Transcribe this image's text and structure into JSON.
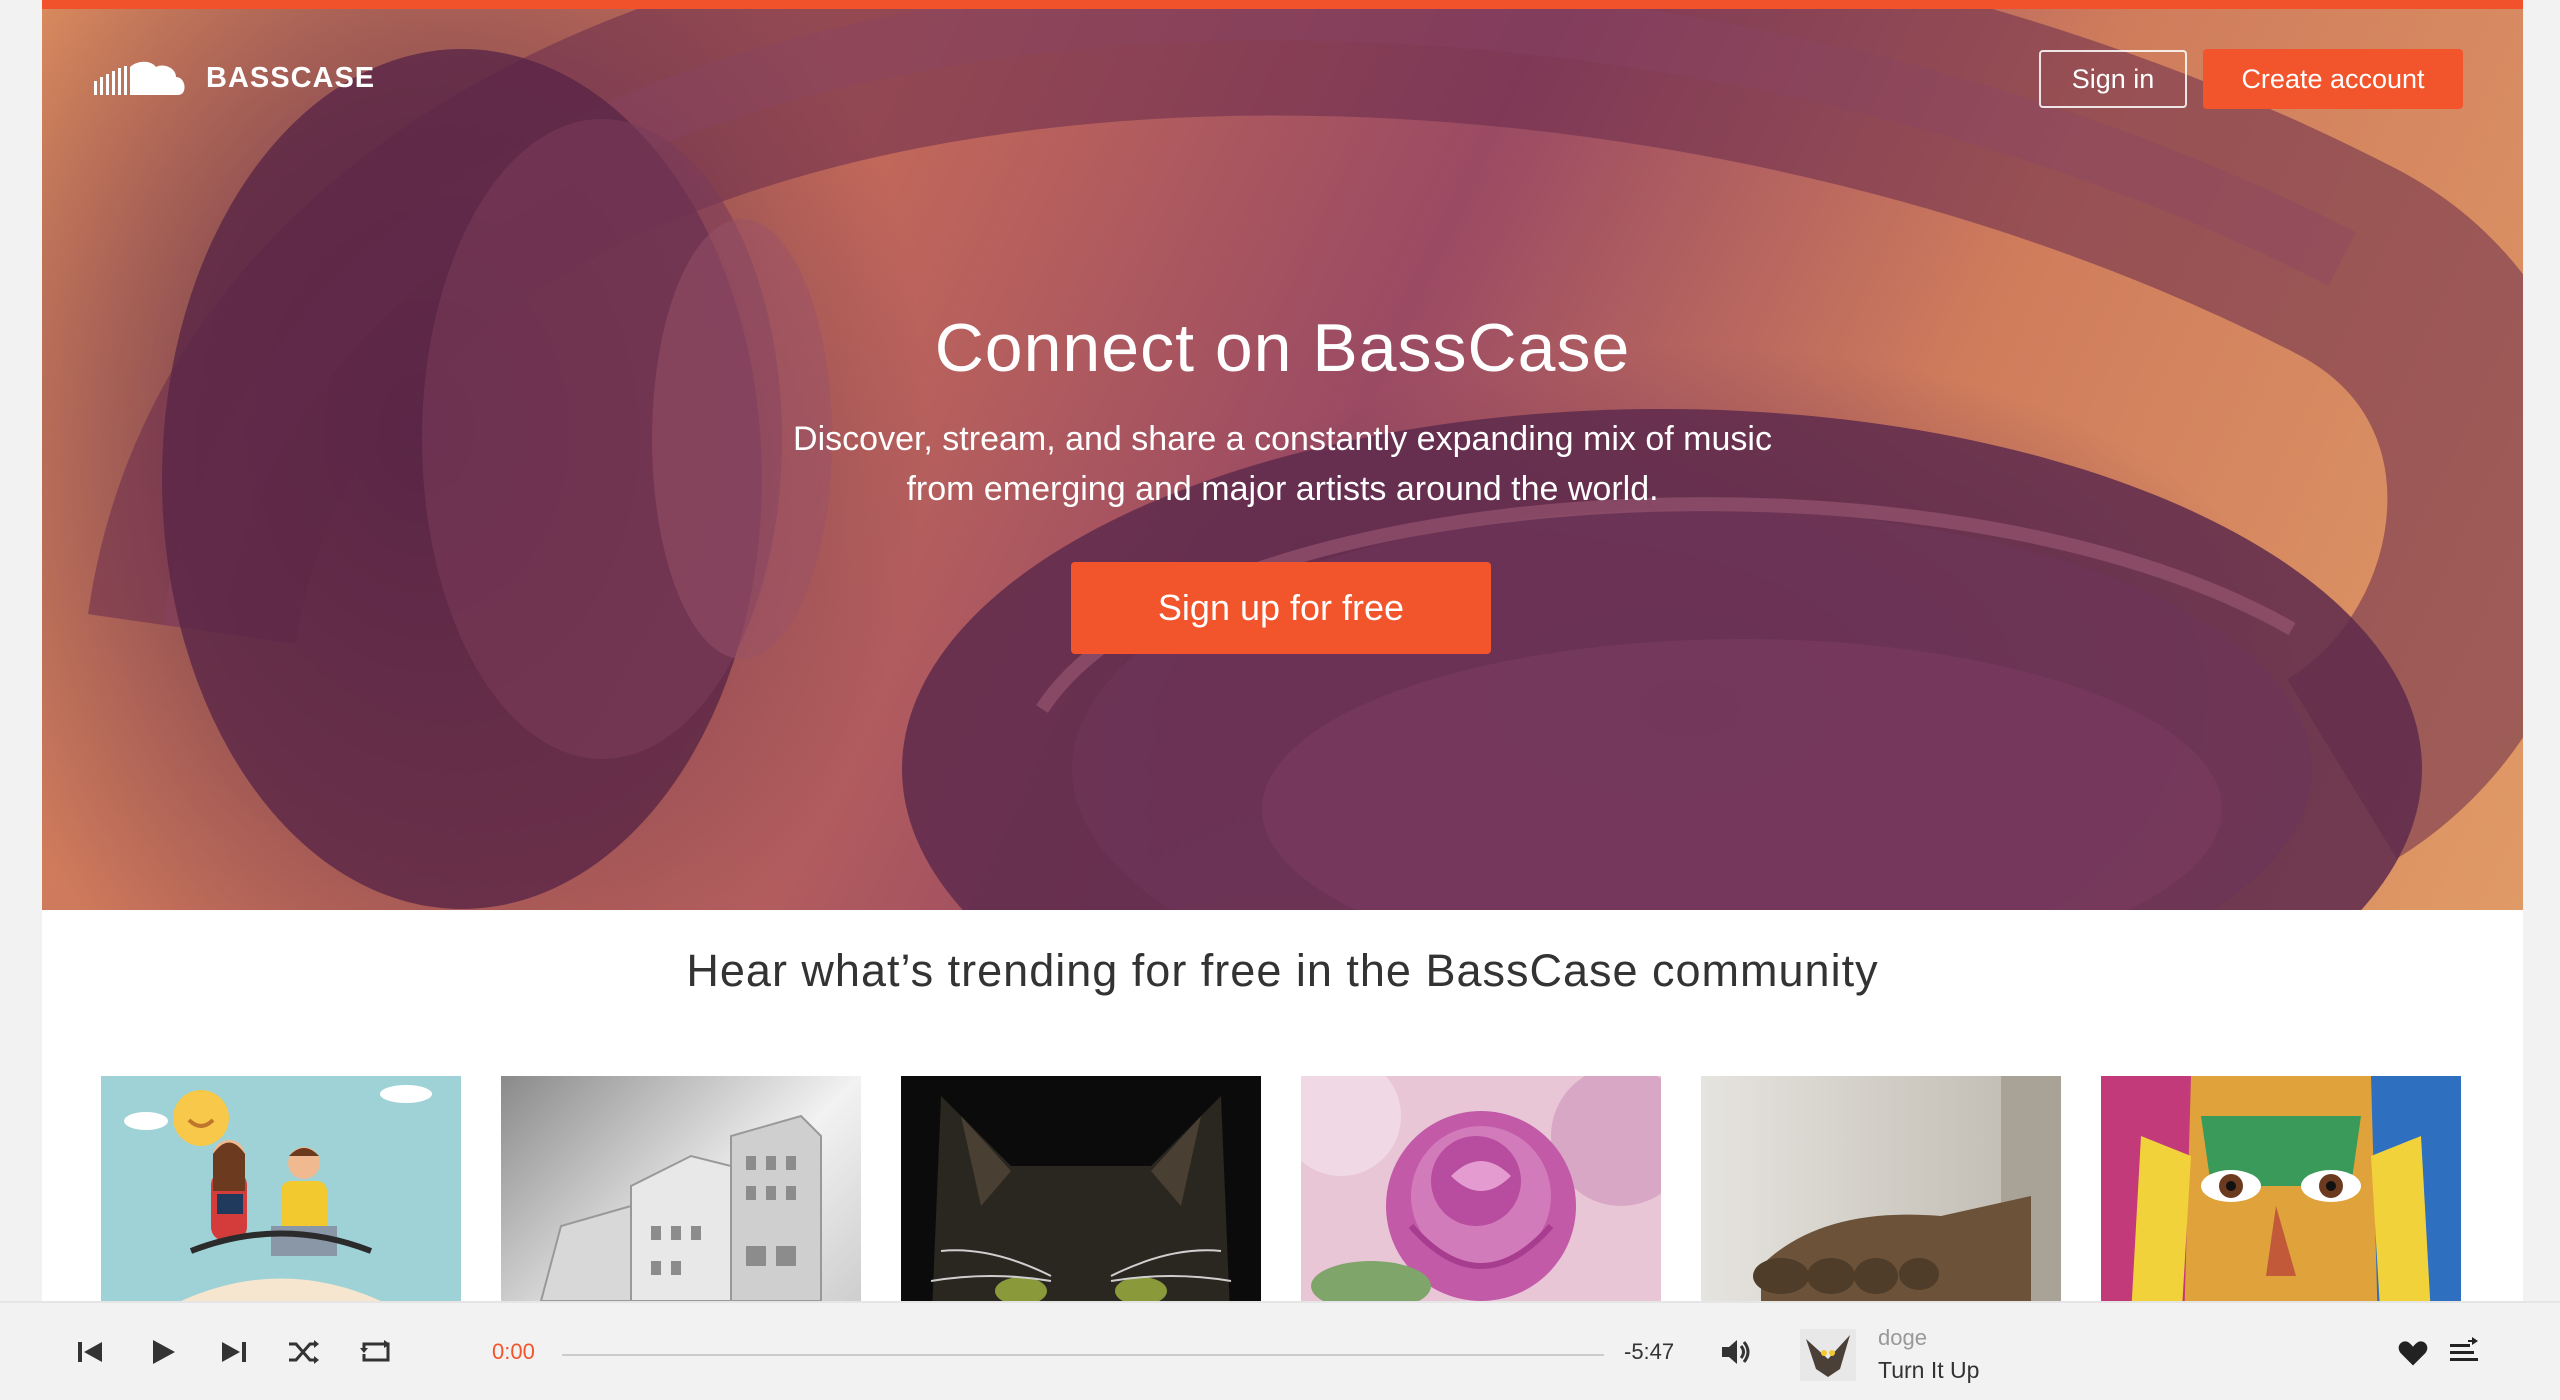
{
  "header": {
    "logo_text": "BASSCASE",
    "sign_in_label": "Sign in",
    "create_account_label": "Create account"
  },
  "hero": {
    "title": "Connect on BassCase",
    "subtitle_line1": "Discover, stream, and share a constantly expanding mix of music",
    "subtitle_line2": "from emerging and major artists around the world.",
    "signup_label": "Sign up for free"
  },
  "trending": {
    "title": "Hear what’s trending for free in the BassCase community",
    "tiles": [
      {
        "name": "people-illustration"
      },
      {
        "name": "city-buildings"
      },
      {
        "name": "cat"
      },
      {
        "name": "pink-rose"
      },
      {
        "name": "sculpture-hand"
      },
      {
        "name": "painted-face"
      }
    ]
  },
  "player": {
    "current_time": "0:00",
    "remaining_time": "-5:47",
    "track_user": "doge",
    "track_title": "Turn It Up",
    "progress": 0
  },
  "colors": {
    "accent": "#f2542c",
    "text_dark": "#333333",
    "text_muted": "#999999"
  }
}
